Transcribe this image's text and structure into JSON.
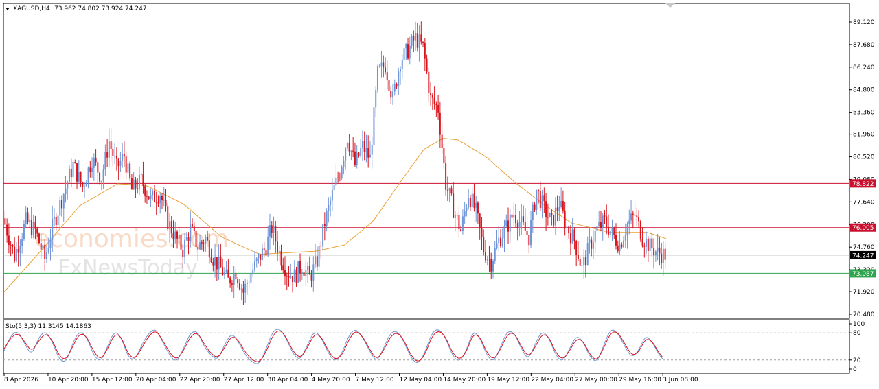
{
  "header": {
    "symbol": "XAGUSD,H4",
    "ohlc": "73.962 74.802 73.924 74.247"
  },
  "watermark": {
    "line1": "economies.com",
    "line2": "FxNewsToday"
  },
  "colors": {
    "bull": "#6f95d6",
    "bear": "#d8141c",
    "ma": "#e8a035",
    "resistance": "#c8102e",
    "support": "#2ea44f",
    "current": "#000000",
    "sto_main": "#6f95d6",
    "sto_signal": "#d8141c"
  },
  "chart_data": [
    {
      "type": "candlestick",
      "ylim": [
        70.48,
        90.0
      ],
      "y_ticks": [
        "89.120",
        "87.680",
        "86.240",
        "84.800",
        "83.360",
        "81.960",
        "80.520",
        "79.080",
        "77.640",
        "76.200",
        "74.760",
        "73.320",
        "71.920",
        "70.480"
      ],
      "x_ticks": [
        "8 Apr 2026",
        "10 Apr 20:00",
        "15 Apr 12:00",
        "20 Apr 04:00",
        "22 Apr 20:00",
        "27 Apr 12:00",
        "30 Apr 04:00",
        "4 May 20:00",
        "7 May 12:00",
        "12 May 04:00",
        "14 May 20:00",
        "19 May 12:00",
        "22 May 04:00",
        "27 May 00:00",
        "29 May 16:00",
        "3 Jun 08:00"
      ],
      "levels": [
        {
          "value": 78.822,
          "label": "78.822",
          "role": "resistance"
        },
        {
          "value": 76.005,
          "label": "76.005",
          "role": "resistance"
        },
        {
          "value": 74.247,
          "label": "74.247",
          "role": "current"
        },
        {
          "value": 73.087,
          "label": "73.087",
          "role": "support"
        }
      ],
      "close_path": [
        [
          0,
          76.6
        ],
        [
          6,
          74.2
        ],
        [
          12,
          76.4
        ],
        [
          17,
          75.8
        ],
        [
          22,
          74.0
        ],
        [
          26,
          76.0
        ],
        [
          32,
          78.2
        ],
        [
          37,
          80.0
        ],
        [
          42,
          78.6
        ],
        [
          47,
          80.4
        ],
        [
          52,
          79.2
        ],
        [
          56,
          81.5
        ],
        [
          60,
          79.8
        ],
        [
          64,
          80.6
        ],
        [
          68,
          78.4
        ],
        [
          73,
          79.0
        ],
        [
          78,
          77.8
        ],
        [
          83,
          78.2
        ],
        [
          87,
          76.4
        ],
        [
          91,
          75.4
        ],
        [
          95,
          74.6
        ],
        [
          99,
          75.9
        ],
        [
          103,
          74.8
        ],
        [
          107,
          75.3
        ],
        [
          111,
          74.1
        ],
        [
          115,
          73.4
        ],
        [
          119,
          72.6
        ],
        [
          123,
          73.2
        ],
        [
          127,
          71.9
        ],
        [
          131,
          73.1
        ],
        [
          135,
          74.0
        ],
        [
          139,
          74.8
        ],
        [
          142,
          76.0
        ],
        [
          146,
          74.4
        ],
        [
          150,
          73.2
        ],
        [
          154,
          72.9
        ],
        [
          158,
          73.6
        ],
        [
          162,
          72.8
        ],
        [
          166,
          73.9
        ],
        [
          170,
          76.3
        ],
        [
          174,
          78.1
        ],
        [
          178,
          79.6
        ],
        [
          182,
          81.8
        ],
        [
          186,
          80.0
        ],
        [
          190,
          81.2
        ],
        [
          194,
          80.4
        ],
        [
          198,
          85.8
        ],
        [
          202,
          86.4
        ],
        [
          206,
          84.2
        ],
        [
          210,
          86.7
        ],
        [
          214,
          87.3
        ],
        [
          218,
          88.1
        ],
        [
          222,
          87.5
        ],
        [
          226,
          84.2
        ],
        [
          230,
          83.6
        ],
        [
          234,
          78.8
        ],
        [
          238,
          77.2
        ],
        [
          242,
          75.8
        ],
        [
          246,
          78.2
        ],
        [
          250,
          77.0
        ],
        [
          254,
          74.6
        ],
        [
          258,
          73.8
        ],
        [
          262,
          75.2
        ],
        [
          266,
          76.0
        ],
        [
          270,
          76.9
        ],
        [
          274,
          76.2
        ],
        [
          278,
          75.4
        ],
        [
          282,
          78.4
        ],
        [
          286,
          77.2
        ],
        [
          290,
          76.3
        ],
        [
          294,
          77.6
        ],
        [
          298,
          76.0
        ],
        [
          302,
          75.2
        ],
        [
          306,
          73.4
        ],
        [
          310,
          74.8
        ],
        [
          314,
          75.9
        ],
        [
          318,
          76.4
        ],
        [
          322,
          75.6
        ],
        [
          326,
          74.9
        ],
        [
          330,
          76.2
        ],
        [
          334,
          76.8
        ],
        [
          338,
          75.4
        ],
        [
          342,
          74.8
        ],
        [
          346,
          74.4
        ],
        [
          350,
          74.25
        ]
      ],
      "ma_path": [
        [
          0,
          71.9
        ],
        [
          20,
          74.6
        ],
        [
          40,
          77.4
        ],
        [
          60,
          78.8
        ],
        [
          75,
          78.7
        ],
        [
          95,
          77.5
        ],
        [
          115,
          75.4
        ],
        [
          135,
          74.3
        ],
        [
          150,
          74.4
        ],
        [
          165,
          74.5
        ],
        [
          180,
          74.9
        ],
        [
          195,
          76.4
        ],
        [
          210,
          79.0
        ],
        [
          222,
          81.0
        ],
        [
          232,
          81.7
        ],
        [
          240,
          81.6
        ],
        [
          255,
          80.5
        ],
        [
          270,
          78.9
        ],
        [
          285,
          77.5
        ],
        [
          300,
          76.3
        ],
        [
          320,
          75.7
        ],
        [
          340,
          75.7
        ],
        [
          350,
          75.3
        ]
      ]
    },
    {
      "type": "line",
      "title": "Sto(5,3,3) 11.3145 14.1863",
      "ylim": [
        0,
        100
      ],
      "y_ticks": [
        "100",
        "80",
        "20",
        "0"
      ],
      "levels": [
        80,
        20
      ],
      "series": [
        {
          "values": [
            40,
            75,
            85,
            55,
            30,
            70,
            85,
            60,
            20,
            15,
            60,
            85,
            70,
            30,
            15,
            50,
            85,
            70,
            25,
            20,
            55,
            80,
            90,
            60,
            30,
            15,
            45,
            80,
            85,
            50,
            30,
            20,
            55,
            80,
            60,
            30,
            15,
            10,
            45,
            85,
            90,
            65,
            30,
            20,
            55,
            85,
            70,
            35,
            15,
            35,
            75,
            90,
            70,
            40,
            15,
            45,
            80,
            85,
            60,
            25,
            10,
            35,
            80,
            90,
            70,
            30,
            15,
            40,
            85,
            70,
            30,
            15,
            50,
            85,
            80,
            45,
            20,
            55,
            85,
            70,
            30,
            15,
            45,
            75,
            60,
            25,
            15,
            55,
            90,
            80,
            50,
            25,
            40,
            75,
            60,
            30,
            15
          ]
        },
        {
          "values": [
            45,
            70,
            80,
            60,
            38,
            62,
            80,
            64,
            28,
            20,
            52,
            80,
            72,
            38,
            20,
            44,
            78,
            72,
            32,
            22,
            48,
            74,
            86,
            64,
            36,
            20,
            40,
            72,
            82,
            56,
            34,
            24,
            48,
            74,
            64,
            36,
            20,
            14,
            38,
            76,
            88,
            68,
            36,
            24,
            48,
            78,
            72,
            40,
            20,
            30,
            66,
            86,
            72,
            44,
            20,
            40,
            72,
            82,
            64,
            30,
            14,
            30,
            72,
            86,
            72,
            36,
            20,
            36,
            78,
            72,
            36,
            20,
            44,
            78,
            80,
            50,
            26,
            48,
            78,
            72,
            36,
            20,
            40,
            68,
            62,
            30,
            18,
            48,
            82,
            82,
            56,
            30,
            36,
            68,
            62,
            34,
            18
          ]
        }
      ]
    }
  ]
}
